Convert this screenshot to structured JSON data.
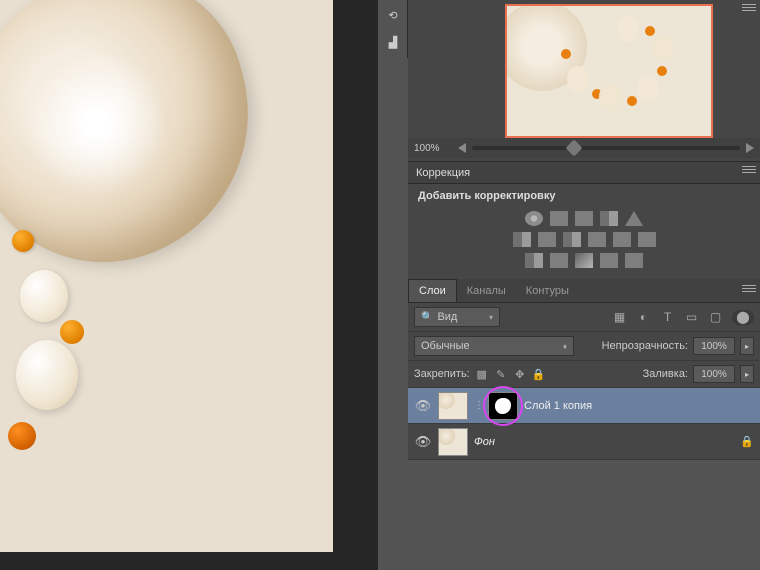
{
  "navigator": {
    "zoom": "100%"
  },
  "adjustments": {
    "panel_title": "Коррекция",
    "add_label": "Добавить корректировку"
  },
  "layers_panel": {
    "tabs": [
      "Слои",
      "Каналы",
      "Контуры"
    ],
    "kind_filter": "Вид",
    "blend_mode": "Обычные",
    "opacity_label": "Непрозрачность:",
    "opacity_value": "100%",
    "lock_label": "Закрепить:",
    "fill_label": "Заливка:",
    "fill_value": "100%",
    "layers": [
      {
        "name": "Слой 1 копия",
        "selected": true,
        "has_mask": true,
        "locked": false
      },
      {
        "name": "Фон",
        "selected": false,
        "has_mask": false,
        "locked": true,
        "italic": true
      }
    ]
  }
}
